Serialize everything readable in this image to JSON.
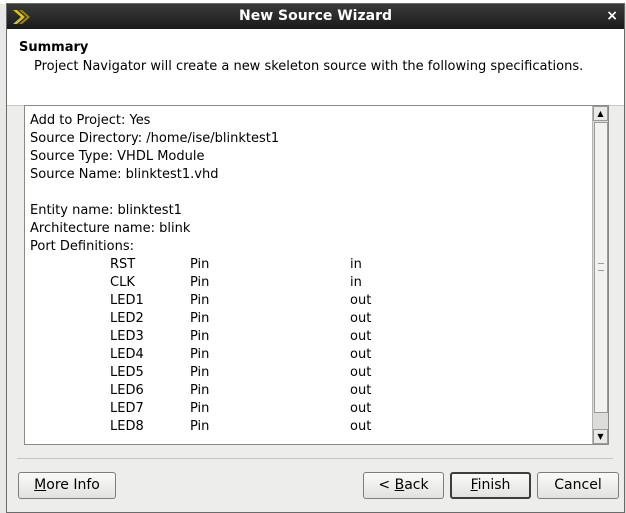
{
  "window": {
    "title": "New Source Wizard",
    "close_glyph": "×"
  },
  "header": {
    "title": "Summary",
    "description": "Project Navigator will create a new skeleton source with the following specifications."
  },
  "summary": {
    "lines": [
      "Add to Project: Yes",
      "Source Directory: /home/ise/blinktest1",
      "Source Type: VHDL Module",
      "Source Name: blinktest1.vhd"
    ],
    "entity_lines": [
      "Entity name: blinktest1",
      "Architecture name: blink",
      "Port Definitions:"
    ],
    "ports": [
      {
        "name": "RST",
        "type": "Pin",
        "dir": "in"
      },
      {
        "name": "CLK",
        "type": "Pin",
        "dir": "in"
      },
      {
        "name": "LED1",
        "type": "Pin",
        "dir": "out"
      },
      {
        "name": "LED2",
        "type": "Pin",
        "dir": "out"
      },
      {
        "name": "LED3",
        "type": "Pin",
        "dir": "out"
      },
      {
        "name": "LED4",
        "type": "Pin",
        "dir": "out"
      },
      {
        "name": "LED5",
        "type": "Pin",
        "dir": "out"
      },
      {
        "name": "LED6",
        "type": "Pin",
        "dir": "out"
      },
      {
        "name": "LED7",
        "type": "Pin",
        "dir": "out"
      },
      {
        "name": "LED8",
        "type": "Pin",
        "dir": "out"
      }
    ]
  },
  "buttons": {
    "more_info": {
      "mnemonic": "M",
      "rest": "ore Info"
    },
    "back": {
      "prefix": "< ",
      "mnemonic": "B",
      "rest": "ack"
    },
    "finish": {
      "mnemonic": "F",
      "rest": "inish"
    },
    "cancel": "Cancel"
  },
  "scrollbar": {
    "up_glyph": "▲",
    "down_glyph": "▼"
  }
}
